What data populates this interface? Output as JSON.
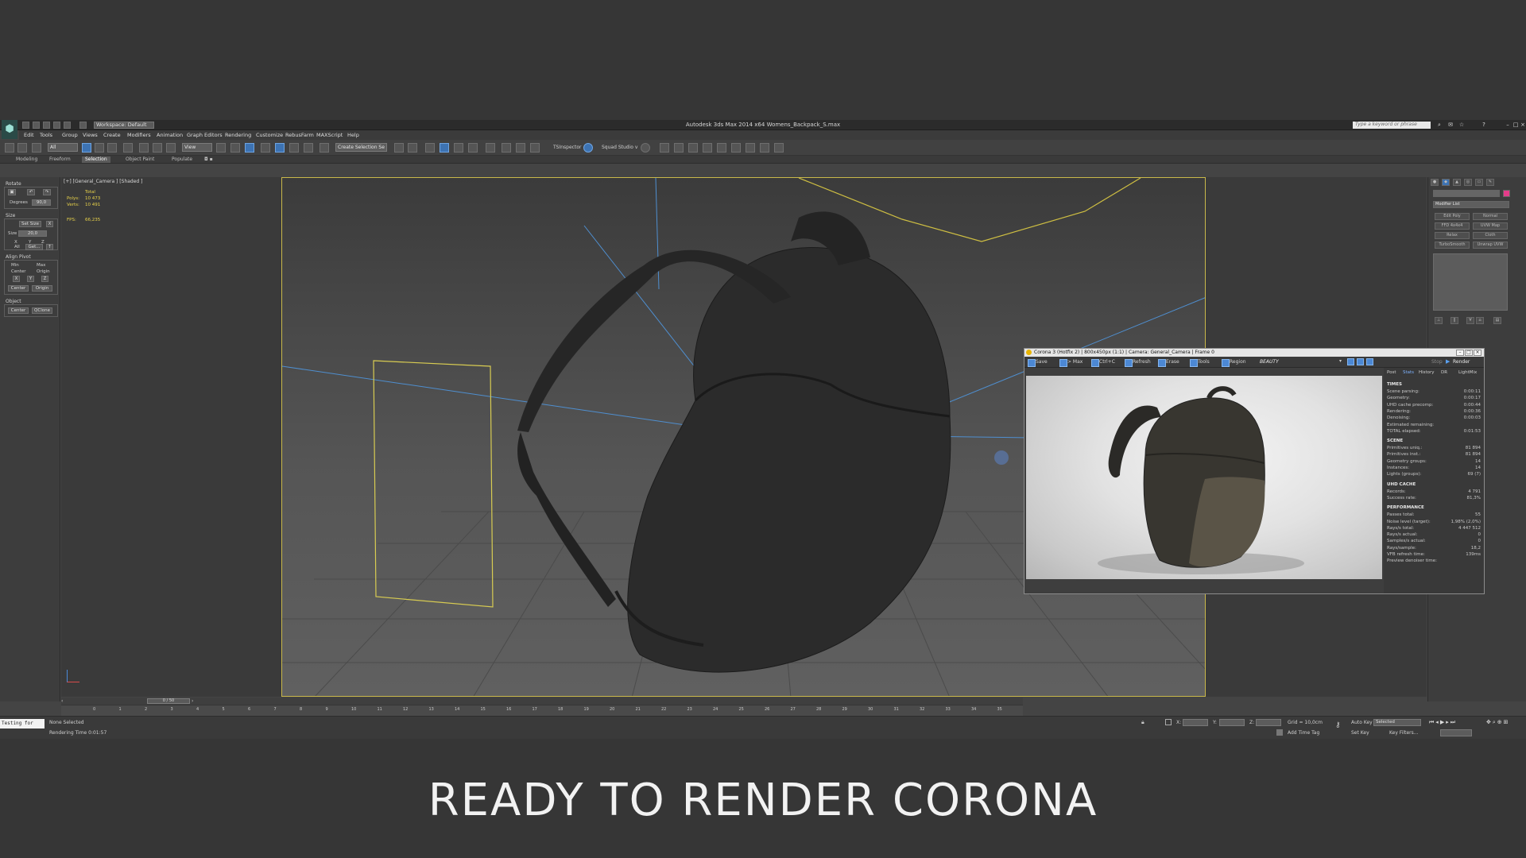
{
  "app": {
    "title": "Autodesk 3ds Max  2014 x64      Womens_Backpack_S.max",
    "workspace": "Workspace: Default",
    "search_placeholder": "Type a keyword or phrase"
  },
  "menu": [
    "Edit",
    "Tools",
    "Group",
    "Views",
    "Create",
    "Modifiers",
    "Animation",
    "Graph Editors",
    "Rendering",
    "Customize",
    "RebusFarm",
    "MAXScript",
    "Help"
  ],
  "toolbar": {
    "filter": "All",
    "coord": "View",
    "selection_set": "Create Selection Se",
    "tsinspector": "TSInspector",
    "squad": "Squad Studio v"
  },
  "ribbon_tabs": [
    "Modeling",
    "Freeform",
    "Selection",
    "Object Paint",
    "Populate"
  ],
  "left_panel": {
    "rotate": "Rotate",
    "degrees_label": "Degrees",
    "degrees_value": "90,0",
    "size": "Size",
    "set_size": "Set Size",
    "size_value": "20,0",
    "x": "X",
    "y": "Y",
    "z": "Z",
    "all": "All",
    "get": "Get...",
    "align_pivot": "Align Pivot",
    "min": "Min",
    "max": "Max",
    "center": "Center",
    "origin": "Origin",
    "object": "Object",
    "qclone": "QClone"
  },
  "viewport": {
    "label": "[+] [General_Camera ] [Shaded ]",
    "total": "Total",
    "polys_label": "Polys:",
    "polys": "10 473",
    "verts_label": "Verts:",
    "verts": "10 491",
    "fps_label": "FPS:",
    "fps": "66,235"
  },
  "right_panel": {
    "modifier_list": "Modifier List",
    "buttons": [
      "Edit Poly",
      "Normal",
      "FFD 4x4x4",
      "UVW Map",
      "Relax",
      "Cloth",
      "TurboSmooth",
      "Unwrap UVW"
    ]
  },
  "timeline": {
    "frame": "0 / 50",
    "ticks": [
      "0",
      "1",
      "2",
      "3",
      "4",
      "5",
      "6",
      "7",
      "8",
      "9",
      "10",
      "11",
      "12",
      "13",
      "14",
      "15",
      "16",
      "17",
      "18",
      "19",
      "20",
      "21",
      "22",
      "23",
      "24",
      "25",
      "26",
      "27",
      "28",
      "29",
      "30",
      "31",
      "32",
      "33",
      "34",
      "35"
    ]
  },
  "status": {
    "maxscript": "Testing for",
    "selection": "None Selected",
    "render_time": "Rendering Time  0:01:57",
    "x_label": "X:",
    "y_label": "Y:",
    "z_label": "Z:",
    "grid": "Grid = 10,0cm",
    "auto_key": "Auto Key",
    "selected": "Selected",
    "set_key": "Set Key",
    "key_filters": "Key Filters...",
    "add_time_tag": "Add Time Tag"
  },
  "vfb": {
    "title": "Corona 3 (Hotfix 2) | 800x450px (1:1) | Camera: General_Camera | Frame 0",
    "tools": [
      "Save",
      "> Max",
      "Ctrl+C",
      "Refresh",
      "Erase",
      "Tools",
      "Region"
    ],
    "channel": "BEAUTY",
    "stop": "Stop",
    "render": "Render",
    "tabs": [
      "Post",
      "Stats",
      "History",
      "DR",
      "LightMix"
    ],
    "sections": [
      {
        "head": "TIMES",
        "rows": [
          [
            "Scene parsing:",
            "0:00:11"
          ],
          [
            "Geometry:",
            "0:00:17"
          ],
          [
            "UHD cache precomp:",
            "0:00:44"
          ],
          [
            "Rendering:",
            "0:00:36"
          ],
          [
            "Denoising:",
            "0:00:03"
          ],
          [
            "Estimated remaining:",
            ""
          ],
          [
            "TOTAL elapsed:",
            "0:01:53"
          ]
        ]
      },
      {
        "head": "SCENE",
        "rows": [
          [
            "Primitives uniq.:",
            "81 894"
          ],
          [
            "Primitives inst.:",
            "81 894"
          ],
          [
            "Geometry groups:",
            "14"
          ],
          [
            "Instances:",
            "14"
          ],
          [
            "Lights (groups):",
            "69 (7)"
          ]
        ]
      },
      {
        "head": "UHD CACHE",
        "rows": [
          [
            "Records:",
            "4 791"
          ],
          [
            "Success rate:",
            "81,3%"
          ]
        ]
      },
      {
        "head": "PERFORMANCE",
        "rows": [
          [
            "Passes total:",
            "55"
          ],
          [
            "Noise level (target):",
            "1,98% (2,0%)"
          ],
          [
            "Rays/s total:",
            "4 447 512"
          ],
          [
            "Rays/s actual:",
            "0"
          ],
          [
            "Samples/s actual:",
            "0"
          ],
          [
            "Rays/sample:",
            "18,2"
          ],
          [
            "VFB refresh time:",
            "139ms"
          ],
          [
            "Preview denoiser time:",
            ""
          ]
        ]
      }
    ]
  },
  "caption": "READY TO RENDER CORONA"
}
